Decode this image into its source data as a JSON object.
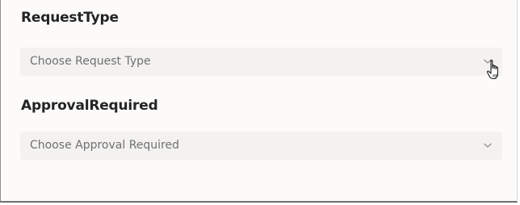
{
  "form": {
    "fields": [
      {
        "label": "RequestType",
        "placeholder": "Choose Request Type",
        "icon": "chevron-down-icon"
      },
      {
        "label": "ApprovalRequired",
        "placeholder": "Choose Approval Required",
        "icon": "chevron-down-icon"
      }
    ]
  },
  "colors": {
    "background": "#fcfbfa",
    "input_fill": "#f3f2f1",
    "label_text": "#242424",
    "placeholder_text": "#707070"
  }
}
